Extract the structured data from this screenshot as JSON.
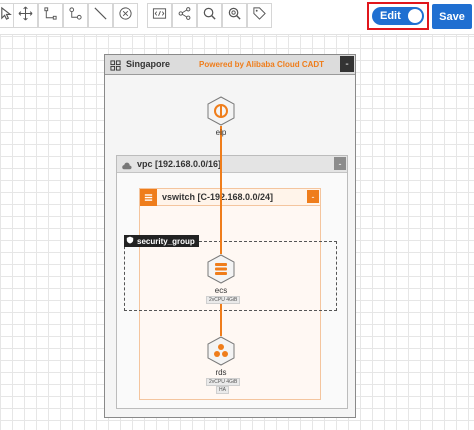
{
  "toolbar": {
    "tools": [
      {
        "icon": "select-icon"
      },
      {
        "icon": "move-icon"
      },
      {
        "icon": "connect-icon"
      },
      {
        "icon": "route-icon"
      },
      {
        "icon": "line-icon"
      },
      {
        "icon": "clear-icon"
      },
      {
        "icon": "code-icon"
      },
      {
        "icon": "share-icon"
      },
      {
        "icon": "search-icon"
      },
      {
        "icon": "zoom-icon"
      },
      {
        "icon": "tag-icon"
      }
    ],
    "edit_label": "Edit",
    "edit_enabled": true,
    "save_label": "Save"
  },
  "diagram": {
    "region": {
      "title": "Singapore",
      "powered_by": "Powered by Alibaba Cloud CADT",
      "collapse": "-"
    },
    "vpc": {
      "title": "vpc [192.168.0.0/16]",
      "collapse": "-"
    },
    "vswitch": {
      "title": "vswitch [C-192.168.0.0/24]",
      "collapse": "-"
    },
    "security_group": {
      "label": "security_group"
    },
    "nodes": {
      "eip": {
        "label": "eip"
      },
      "ecs": {
        "label": "ecs",
        "tag": "2vCPU 4GiB"
      },
      "rds": {
        "label": "rds",
        "tags": [
          "2vCPU 4GiB",
          "HA"
        ]
      }
    }
  },
  "colors": {
    "accent": "#1f6fd1",
    "orange": "#ef7d1b",
    "highlight": "#e0161c"
  }
}
